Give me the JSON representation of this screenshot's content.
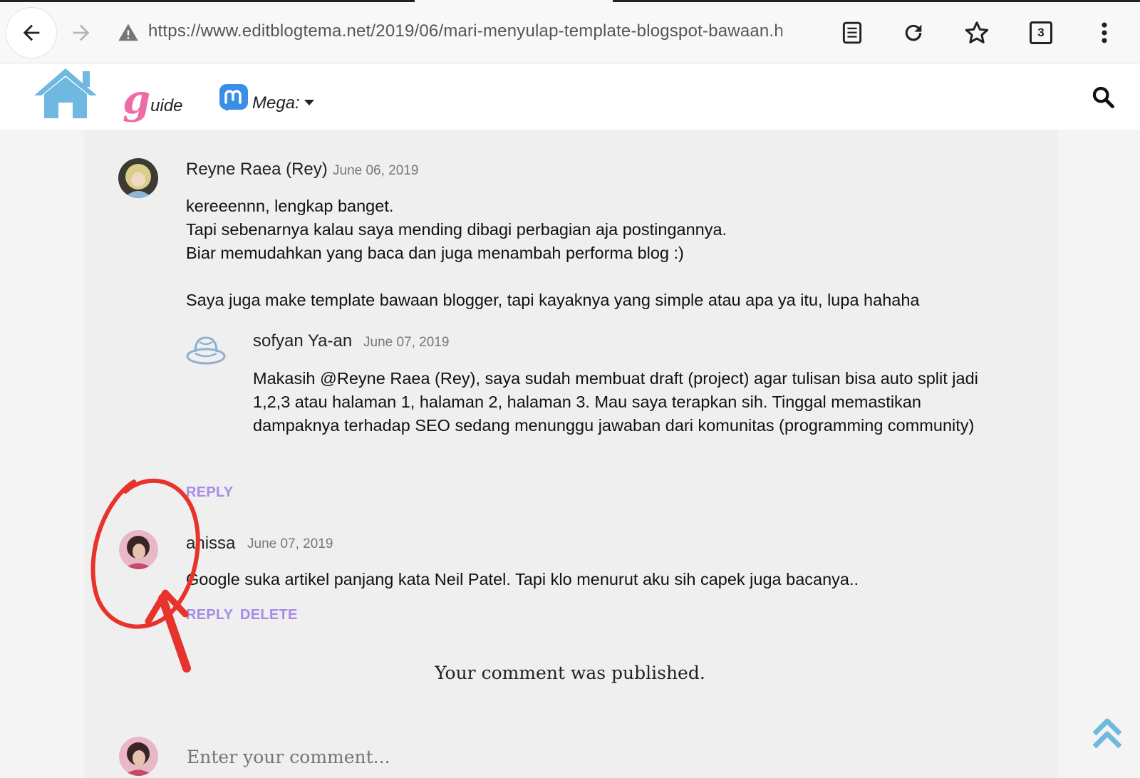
{
  "browser": {
    "url": "https://www.editblogtema.net/2019/06/mari-menyulap-template-blogspot-bawaan.h",
    "tab_count": "3"
  },
  "site_nav": {
    "guide_letter": "g",
    "guide_rest": "uide",
    "mega_label": "Mega:"
  },
  "comments": [
    {
      "author": "Reyne Raea (Rey)",
      "date": "June 06, 2019",
      "lines": [
        "kereeennn, lengkap banget.",
        "Tapi sebenarnya kalau saya mending dibagi perbagian aja postingannya.",
        "Biar memudahkan yang baca dan juga menambah performa blog :)",
        "",
        "Saya juga make template bawaan blogger, tapi kayaknya yang simple atau apa ya itu, lupa hahaha"
      ],
      "reply": {
        "author": "sofyan Ya-an",
        "date": "June 07, 2019",
        "lines": [
          "Makasih @Reyne Raea (Rey), saya sudah membuat draft (project) agar tulisan bisa auto split jadi",
          "1,2,3 atau halaman 1, halaman 2, halaman 3. Mau saya terapkan sih. Tinggal memastikan",
          "dampaknya terhadap SEO sedang menunggu jawaban dari komunitas (programming community)"
        ]
      },
      "reply_label": "REPLY"
    },
    {
      "author": "anissa",
      "date": "June 07, 2019",
      "lines": [
        "Google suka artikel panjang kata Neil Patel. Tapi klo menurut aku sih capek juga bacanya.."
      ],
      "reply_label": "REPLY",
      "delete_label": "DELETE"
    }
  ],
  "status_message": "Your comment was published.",
  "comment_input": {
    "placeholder": "Enter your comment..."
  },
  "colors": {
    "action": "#a78ce6",
    "annotation": "#e8322c",
    "home_logo": "#6fb8e0",
    "guide_logo": "#f06aa8",
    "mega_logo": "#3a8ee6"
  },
  "icons": {
    "back": "arrow-left-icon",
    "forward": "arrow-right-icon",
    "warning": "warning-icon",
    "reader": "reader-mode-icon",
    "reload": "reload-icon",
    "bookmark": "star-icon",
    "tabs": "tabs-icon",
    "menu": "kebab-menu-icon",
    "home": "home-icon",
    "search": "search-icon",
    "scroll_top": "double-chevron-up-icon"
  }
}
